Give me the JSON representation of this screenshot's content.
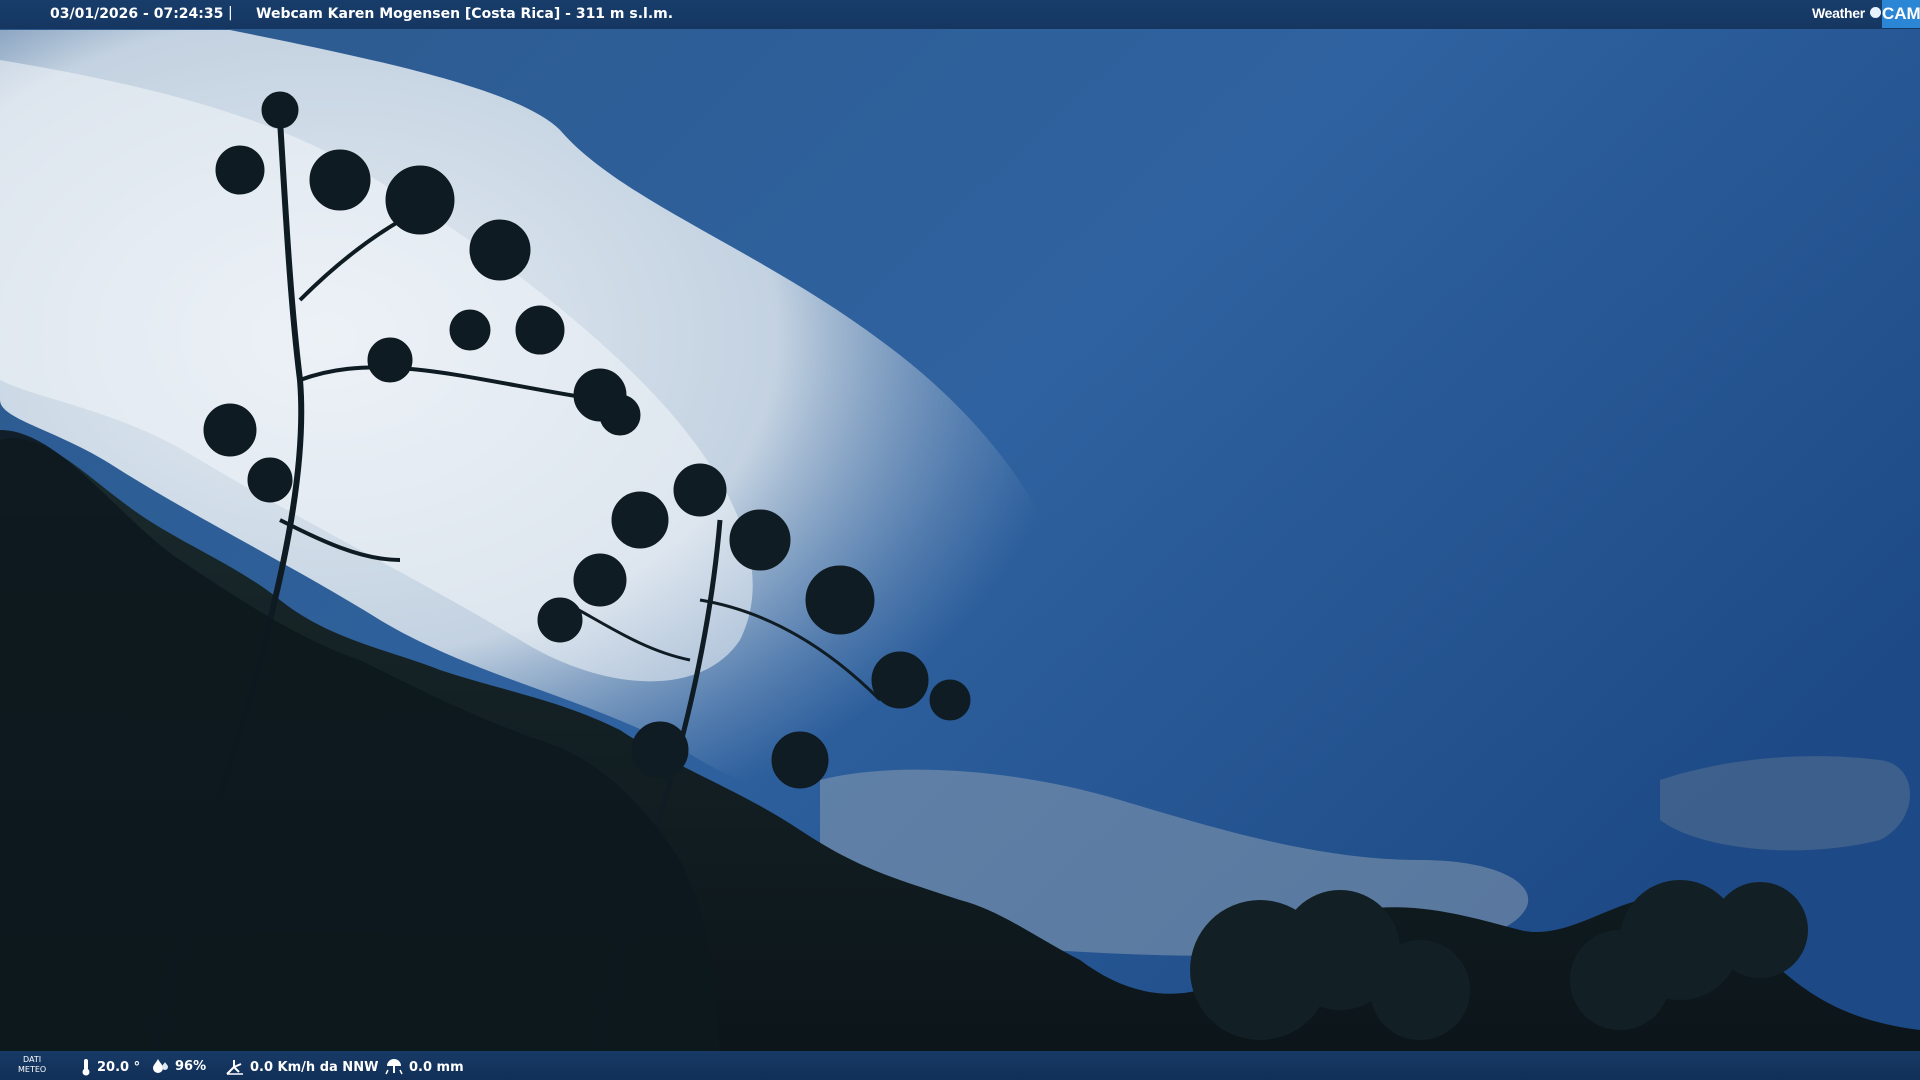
{
  "header": {
    "timestamp": "03/01/2026 - 07:24:35",
    "separator": "|",
    "title": "Webcam Karen Mogensen [Costa Rica]  - 311 m s.l.m."
  },
  "logo": {
    "weather": "Weather",
    "cam": "CAM"
  },
  "footer": {
    "dati_line1": "DATI",
    "dati_line2": "METEO",
    "temperature": "20.0 °",
    "humidity": "96%",
    "wind": "0.0 Km/h da NNW",
    "rain": "0.0 mm"
  },
  "icons": [
    "thermometer-icon",
    "humidity-icon",
    "wind-icon",
    "rain-gauge-icon"
  ],
  "colors": {
    "bar": "#163a66",
    "sky": "#2f5f96",
    "logo_accent": "#2b86d6"
  }
}
